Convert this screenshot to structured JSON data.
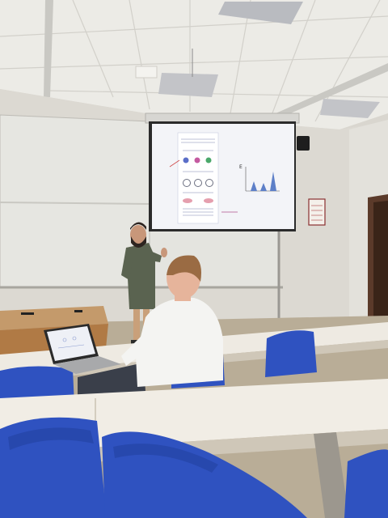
{
  "scene": {
    "description_free": true,
    "colors": {
      "ceiling": "#ecebe6",
      "wall": "#dcd9d2",
      "whiteboard": "#e6e6e1",
      "screen": "#f3f4f8",
      "desk": "#eeeae2",
      "desk_edge": "#cfc7b8",
      "chair_blue": "#2f52c0",
      "floor": "#b9ad97",
      "presenter_shirt": "#5a6350",
      "audience_shirt": "#f4f4f2"
    },
    "slide": {
      "panel_label": "E"
    }
  }
}
